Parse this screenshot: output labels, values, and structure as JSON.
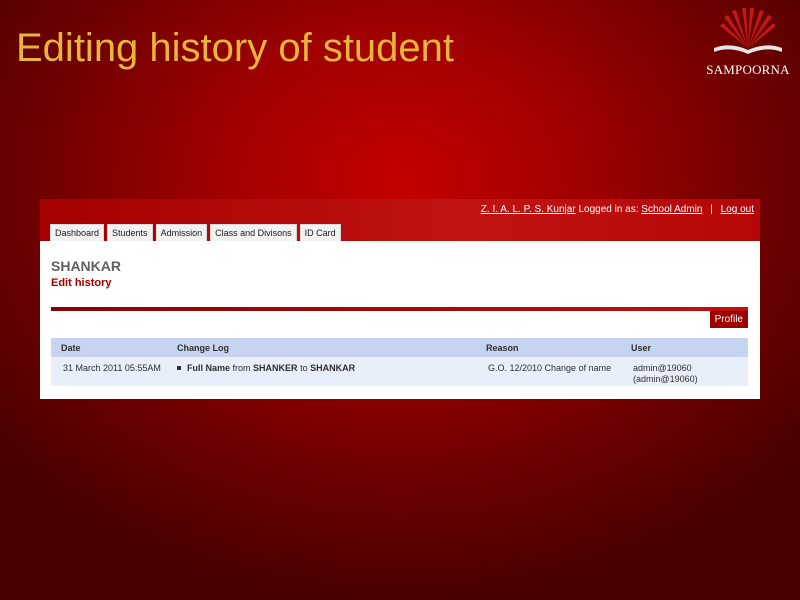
{
  "slide": {
    "title": "Editing history of student",
    "logo_text": "SAMPOORNA",
    "title_color": "#e7b53a"
  },
  "header": {
    "school": "Z. I. A. L. P. S. Kunjar",
    "logged_in_label": "Logged in as:",
    "user_link": "School Admin",
    "separator": "|",
    "logout": "Log out"
  },
  "tabs": [
    {
      "label": "Dashboard"
    },
    {
      "label": "Students"
    },
    {
      "label": "Admission"
    },
    {
      "label": "Class and Divisons"
    },
    {
      "label": "ID Card"
    }
  ],
  "student": {
    "name": "SHANKAR",
    "page_subtitle": "Edit history"
  },
  "profile_button": "Profile",
  "table": {
    "headers": {
      "date": "Date",
      "change_log": "Change Log",
      "reason": "Reason",
      "user": "User"
    },
    "rows": [
      {
        "date": "31 March 2011 05:55AM",
        "field": "Full Name",
        "from_label": "from",
        "old_value": "SHANKER",
        "to_label": "to",
        "new_value": "SHANKAR",
        "reason": "G.O. 12/2010 Change of name",
        "user_line1": "admin@19060",
        "user_line2": "(admin@19060)"
      }
    ]
  },
  "colors": {
    "accent_red": "#a00000",
    "table_header_bg": "#c6d4f1",
    "table_row_bg": "#e8eefa"
  }
}
